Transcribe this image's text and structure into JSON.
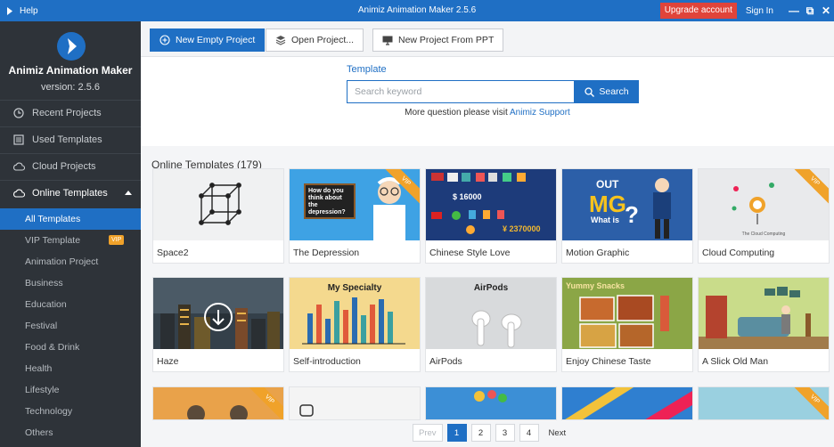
{
  "titlebar": {
    "help": "Help",
    "title": "Animiz Animation Maker 2.5.6",
    "upgrade": "Upgrade account",
    "signin": "Sign In",
    "minimize": "—",
    "restore": "⧉",
    "close": "✕"
  },
  "sidebar": {
    "app_name": "Animiz Animation Maker",
    "version": "version: 2.5.6",
    "nav": [
      {
        "label": "Recent Projects",
        "icon": "clock-icon"
      },
      {
        "label": "Used Templates",
        "icon": "list-icon"
      },
      {
        "label": "Cloud Projects",
        "icon": "cloud-icon"
      },
      {
        "label": "Online Templates",
        "icon": "cloud-icon"
      }
    ],
    "sub_items": [
      {
        "label": "All Templates",
        "active": true
      },
      {
        "label": "VIP Template",
        "badge": "VIP"
      },
      {
        "label": "Animation Project"
      },
      {
        "label": "Business"
      },
      {
        "label": "Education"
      },
      {
        "label": "Festival"
      },
      {
        "label": "Food & Drink"
      },
      {
        "label": "Health"
      },
      {
        "label": "Lifestyle"
      },
      {
        "label": "Technology"
      },
      {
        "label": "Others"
      }
    ]
  },
  "toolbar": {
    "new_empty": "New Empty Project",
    "open_project": "Open Project...",
    "new_from_ppt": "New Project From PPT"
  },
  "search": {
    "label": "Template",
    "placeholder": "Search keyword",
    "button": "Search",
    "support_text": "More question please visit",
    "support_link": "Animiz Support"
  },
  "gallery": {
    "title": "Online Templates (179)",
    "vip_label": "VIP",
    "cards": [
      {
        "name": "Space2"
      },
      {
        "name": "The Depression",
        "vip": true,
        "thumb_text": "How do you think about the depression?"
      },
      {
        "name": "Chinese Style Love",
        "thumb_text_1": "$ 16000",
        "thumb_text_2": "¥ 2370000"
      },
      {
        "name": "Motion Graphic",
        "thumb_text_1": "OUT",
        "thumb_text_2": "MG",
        "thumb_text_3": "What is"
      },
      {
        "name": "Cloud Computing",
        "vip": true,
        "thumb_text": "The Cloud Computing"
      },
      {
        "name": "Haze"
      },
      {
        "name": "Self-introduction",
        "thumb_text": "My Specialty"
      },
      {
        "name": "AirPods",
        "thumb_text": "AirPods"
      },
      {
        "name": "Enjoy Chinese Taste",
        "thumb_text": "Yummy Snacks"
      },
      {
        "name": "A Slick Old Man"
      }
    ]
  },
  "pagination": {
    "prev": "Prev",
    "pages": [
      "1",
      "2",
      "3",
      "4"
    ],
    "current": "1",
    "next": "Next"
  },
  "colors": {
    "accent": "#1f6fc4",
    "sidebar_bg": "#2e3339",
    "vip": "#f0a22a",
    "upgrade": "#e0443a"
  }
}
